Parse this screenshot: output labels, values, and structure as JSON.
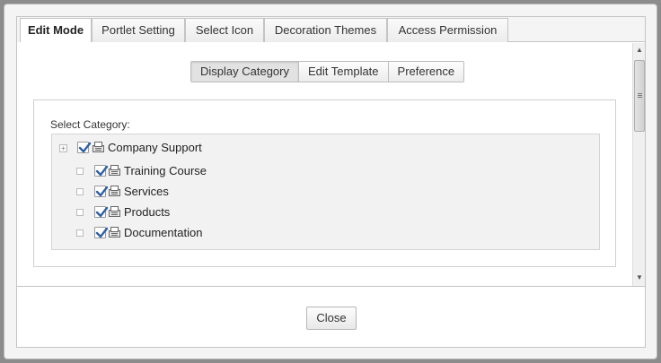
{
  "tabs": [
    {
      "label": "Edit Mode",
      "active": true
    },
    {
      "label": "Portlet Setting",
      "active": false
    },
    {
      "label": "Select Icon",
      "active": false
    },
    {
      "label": "Decoration Themes",
      "active": false
    },
    {
      "label": "Access Permission",
      "active": false
    }
  ],
  "subtabs": [
    {
      "label": "Display Category",
      "active": true
    },
    {
      "label": "Edit Template",
      "active": false
    },
    {
      "label": "Preference",
      "active": false
    }
  ],
  "select_category_label": "Select Category:",
  "tree": {
    "root": {
      "label": "Company Support",
      "checked": true,
      "icon": "category-folder-icon",
      "expander_icon": "expand-plus-icon"
    },
    "children": [
      {
        "label": "Training Course",
        "checked": true,
        "icon": "category-folder-icon"
      },
      {
        "label": "Services",
        "checked": true,
        "icon": "category-folder-icon"
      },
      {
        "label": "Products",
        "checked": true,
        "icon": "category-folder-icon"
      },
      {
        "label": "Documentation",
        "checked": true,
        "icon": "category-folder-icon"
      }
    ]
  },
  "footer": {
    "close_label": "Close"
  },
  "colors": {
    "accent_button": "#5a88c4",
    "checkmark": "#2f5fa6"
  }
}
